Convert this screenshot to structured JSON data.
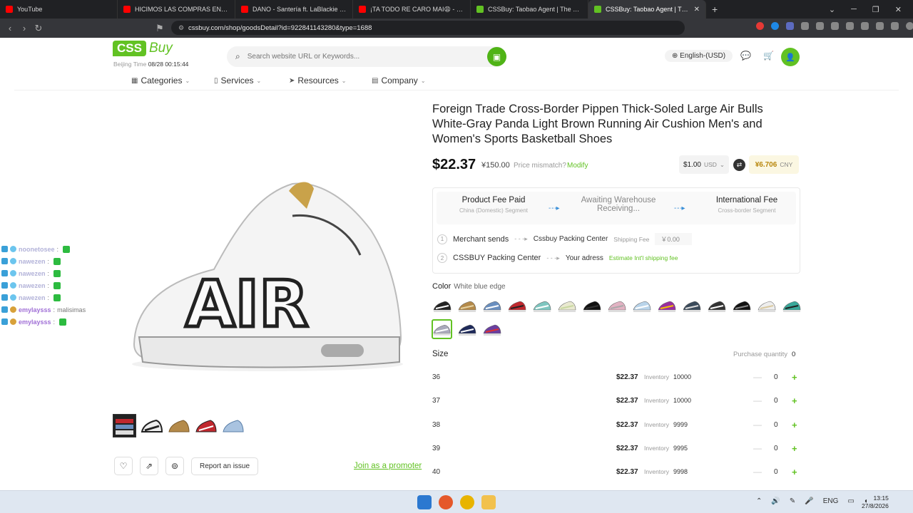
{
  "browser": {
    "tabs": [
      {
        "title": "YouTube",
        "color": "#ff0000"
      },
      {
        "title": "HICIMOS LAS COMPRAS EN UN MAYORISTA",
        "color": "#ff0000"
      },
      {
        "title": "DANO - Santería ft. LaBlackie (Visualizer)",
        "color": "#ff0000"
      },
      {
        "title": "¡TA TODO RE CARO MAI😩 - COMPRAS",
        "color": "#ff0000"
      },
      {
        "title": "CSSBuy: Taobao Agent | The best shopping",
        "color": "#62c223"
      },
      {
        "title": "CSSBuy: Taobao Agent | The best sh",
        "color": "#62c223"
      }
    ],
    "url": "cssbuy.com/shop/goodsDetail?id=922841143280&type=1688"
  },
  "header": {
    "logo_css": "CSS",
    "logo_buy": "Buy",
    "beijing_label": "Beijing Time",
    "beijing_time": "08/28 00:15:44",
    "search_placeholder": "Search website URL or Keywords...",
    "language": "English-(USD)"
  },
  "menu": [
    {
      "label": "Categories"
    },
    {
      "label": "Services"
    },
    {
      "label": "Resources"
    },
    {
      "label": "Company"
    }
  ],
  "chat": [
    {
      "name": "noonetosee",
      "msg": ""
    },
    {
      "name": "nawezen",
      "msg": ""
    },
    {
      "name": "nawezen",
      "msg": ""
    },
    {
      "name": "nawezen",
      "msg": ""
    },
    {
      "name": "nawezen",
      "msg": ""
    },
    {
      "name": "emylaysss",
      "msg": "malisimas"
    },
    {
      "name": "emylaysss",
      "msg": ""
    }
  ],
  "product": {
    "title": "Foreign Trade Cross-Border Pippen Thick-Soled Large Air Bulls White-Gray Panda Light Brown Running Air Cushion Men's and Women's Sports Basketball Shoes",
    "price_usd": "$22.37",
    "price_cny": "¥150.00",
    "mismatch": "Price mismatch?",
    "modify": "Modify",
    "conv_from_amount": "$1.00",
    "conv_from_cur": "USD",
    "conv_to_amount": "¥6.706",
    "conv_to_cur": "CNY"
  },
  "fees": {
    "col1_title": "Product Fee Paid",
    "col1_sub": "China (Domestic) Segment",
    "col2_title": "Awaiting Warehouse Receiving...",
    "col3_title": "International Fee",
    "col3_sub": "Cross-border Segment",
    "row1_num": "1",
    "row1_from": "Merchant sends",
    "row1_to": "Cssbuy Packing Center",
    "row1_fee_label": "Shipping Fee",
    "row1_fee_value": "￥0.00",
    "row2_num": "2",
    "row2_from": "CSSBUY Packing Center",
    "row2_to": "Your adress",
    "row2_est": "Estimate Int'l shipping fee"
  },
  "color": {
    "label": "Color",
    "selected": "White blue edge",
    "swatches": [
      {
        "shoe": "#222",
        "accent": "#fff"
      },
      {
        "shoe": "#b48a4a",
        "accent": "#e6d3a3"
      },
      {
        "shoe": "#6a8fbf",
        "accent": "#fff"
      },
      {
        "shoe": "#c0282e",
        "accent": "#222"
      },
      {
        "shoe": "#7fc6c0",
        "accent": "#fff"
      },
      {
        "shoe": "#e9e9d0",
        "accent": "#c8d8a0"
      },
      {
        "shoe": "#111",
        "accent": "#333"
      },
      {
        "shoe": "#e2b3c3",
        "accent": "#aaa"
      },
      {
        "shoe": "#b9d4ea",
        "accent": "#fff"
      },
      {
        "shoe": "#9a2f9e",
        "accent": "#f2c300"
      },
      {
        "shoe": "#3a4a5a",
        "accent": "#ddd"
      },
      {
        "shoe": "#333",
        "accent": "#fff"
      },
      {
        "shoe": "#111",
        "accent": "#888"
      },
      {
        "shoe": "#eee",
        "accent": "#d9c9a0"
      },
      {
        "shoe": "#3aa89a",
        "accent": "#222"
      },
      {
        "shoe": "#aab",
        "accent": "#fff"
      },
      {
        "shoe": "#1e2a5a",
        "accent": "#fff"
      },
      {
        "shoe": "#6a3fa0",
        "accent": "#e03030"
      }
    ],
    "selected_index": 15
  },
  "size": {
    "label": "Size",
    "qty_label": "Purchase quantity",
    "qty_total": "0",
    "inventory_label": "Inventory",
    "rows": [
      {
        "size": "36",
        "price": "$22.37",
        "inventory": "10000",
        "qty": "0"
      },
      {
        "size": "37",
        "price": "$22.37",
        "inventory": "10000",
        "qty": "0"
      },
      {
        "size": "38",
        "price": "$22.37",
        "inventory": "9999",
        "qty": "0"
      },
      {
        "size": "39",
        "price": "$22.37",
        "inventory": "9995",
        "qty": "0"
      },
      {
        "size": "40",
        "price": "$22.37",
        "inventory": "9998",
        "qty": "0"
      }
    ]
  },
  "actions": {
    "report": "Report an issue",
    "promoter": "Join as a promoter"
  },
  "taskbar": {
    "lang": "ENG",
    "time": "13:15",
    "date": "27/8/2026"
  },
  "colors": {
    "brand": "#62c223",
    "chrome_dark": "#202124"
  }
}
